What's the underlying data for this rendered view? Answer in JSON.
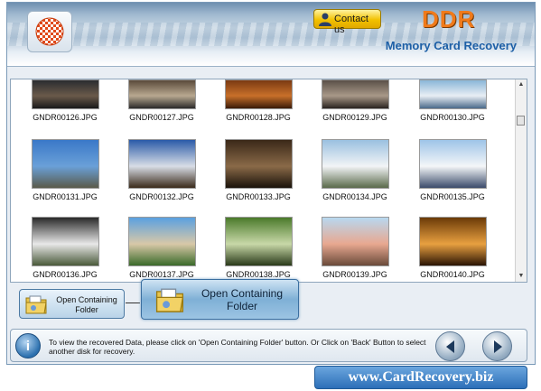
{
  "header": {
    "contact_label": "Contact us",
    "brand": "DDR",
    "subtitle": "Memory Card Recovery"
  },
  "gallery": {
    "items": [
      {
        "name": "GNDR00126.JPG",
        "colors": [
          "#2a2c30",
          "#6a5a4a",
          "#1a1a1a"
        ]
      },
      {
        "name": "GNDR00127.JPG",
        "colors": [
          "#5a4a3a",
          "#b8a890",
          "#2a2a2a"
        ]
      },
      {
        "name": "GNDR00128.JPG",
        "colors": [
          "#7a3a12",
          "#c8702a",
          "#3a1a08"
        ]
      },
      {
        "name": "GNDR00129.JPG",
        "colors": [
          "#5a5048",
          "#a89888",
          "#2a2420"
        ]
      },
      {
        "name": "GNDR00130.JPG",
        "colors": [
          "#8ab6d8",
          "#e8eef4",
          "#4a6a8a"
        ]
      },
      {
        "name": "GNDR00131.JPG",
        "colors": [
          "#3a78c8",
          "#6aa0d8",
          "#5a5a4a"
        ]
      },
      {
        "name": "GNDR00132.JPG",
        "colors": [
          "#2a5aa8",
          "#d8dde6",
          "#3a2a1a"
        ]
      },
      {
        "name": "GNDR00133.JPG",
        "colors": [
          "#3a2818",
          "#8a6a48",
          "#1a120a"
        ]
      },
      {
        "name": "GNDR00134.JPG",
        "colors": [
          "#9ac0e0",
          "#f2f4f6",
          "#5a6a4a"
        ]
      },
      {
        "name": "GNDR00135.JPG",
        "colors": [
          "#9ec4e8",
          "#f4f6f8",
          "#3a4a6a"
        ]
      },
      {
        "name": "GNDR00136.JPG",
        "colors": [
          "#2a2a2a",
          "#e8e8e8",
          "#4a5a3a"
        ]
      },
      {
        "name": "GNDR00137.JPG",
        "colors": [
          "#5aa0e0",
          "#d8c8a8",
          "#3a6a2a"
        ]
      },
      {
        "name": "GNDR00138.JPG",
        "colors": [
          "#4a7a2a",
          "#c8d8a8",
          "#2a3a1a"
        ]
      },
      {
        "name": "GNDR00139.JPG",
        "colors": [
          "#b8d8f0",
          "#e8a890",
          "#6a4a3a"
        ]
      },
      {
        "name": "GNDR00140.JPG",
        "colors": [
          "#6a3a08",
          "#e8a040",
          "#2a1404"
        ]
      }
    ]
  },
  "buttons": {
    "open_folder_small_line1": "Open Containing",
    "open_folder_small_line2": "Folder",
    "open_folder_large_line1": "Open Containing",
    "open_folder_large_line2": "Folder"
  },
  "footer": {
    "info_glyph": "i",
    "message": "To view the recovered Data, please click on 'Open Containing Folder' button. Or Click on 'Back' Button to select another disk for recovery."
  },
  "website": "www.CardRecovery.biz"
}
